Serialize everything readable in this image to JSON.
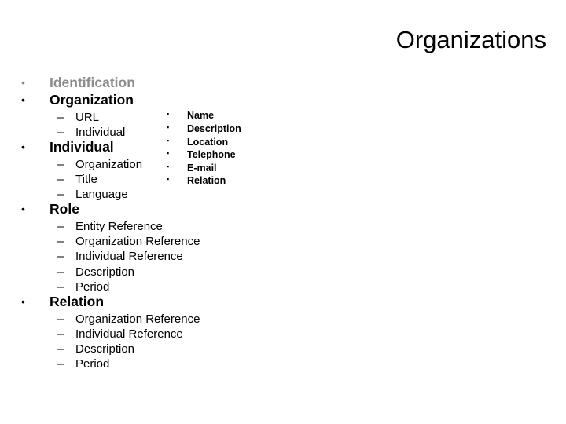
{
  "title": "Organizations",
  "outline": [
    {
      "label": "Identification",
      "muted": true,
      "children": []
    },
    {
      "label": "Organization",
      "children": [
        "URL",
        "Individual"
      ]
    },
    {
      "label": "Individual",
      "children": [
        "Organization",
        "Title",
        "Language"
      ]
    },
    {
      "label": "Role",
      "children": [
        "Entity Reference",
        "Organization Reference",
        "Individual Reference",
        "Description",
        "Period"
      ]
    },
    {
      "label": "Relation",
      "children": [
        "Organization Reference",
        "Individual Reference",
        "Description",
        "Period"
      ]
    }
  ],
  "side_list": [
    "Name",
    "Description",
    "Location",
    "Telephone",
    "E-mail",
    "Relation"
  ],
  "glyphs": {
    "bullet": "•",
    "dash": "–",
    "square_bullet": "▪"
  },
  "colors": {
    "muted_text": "#8c8c8c",
    "text": "#000000",
    "background": "#ffffff"
  }
}
